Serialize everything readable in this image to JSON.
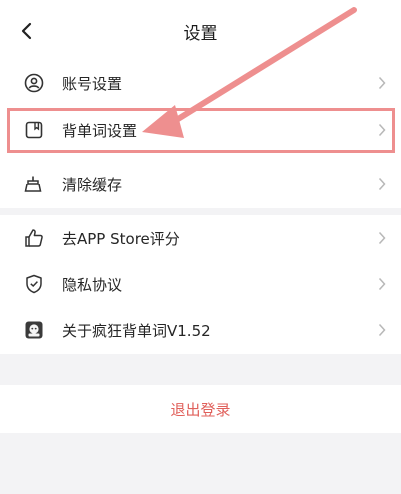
{
  "header": {
    "back_icon": "chevron-left-icon",
    "title": "设置"
  },
  "groups": [
    {
      "items": [
        {
          "label": "账号设置",
          "icon": "user-circle-icon"
        },
        {
          "label": "背单词设置",
          "icon": "bookmark-square-icon"
        },
        {
          "label": "清除缓存",
          "icon": "broom-icon"
        }
      ]
    },
    {
      "items": [
        {
          "label": "去APP Store评分",
          "icon": "thumbs-up-icon"
        },
        {
          "label": "隐私协议",
          "icon": "shield-check-icon"
        },
        {
          "label": "关于疯狂背单词V1.52",
          "icon": "app-logo-icon"
        }
      ]
    }
  ],
  "logout": {
    "label": "退出登录"
  },
  "colors": {
    "background": "#f3f3f5",
    "logout_text": "#e0605b",
    "annotation": "#ee8f8f"
  }
}
